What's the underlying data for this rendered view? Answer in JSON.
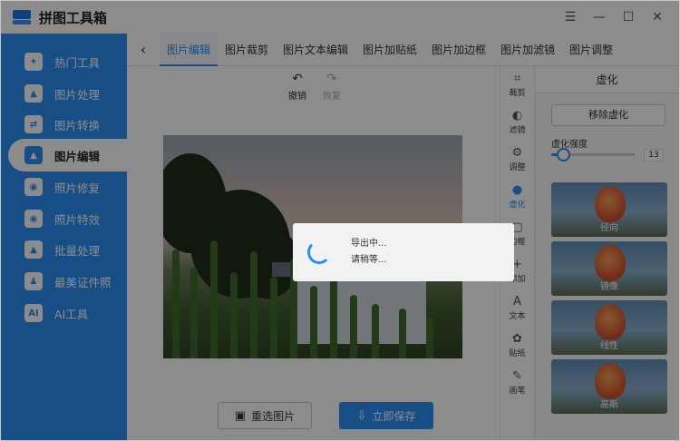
{
  "app": {
    "title": "拼图工具箱"
  },
  "window_controls": {
    "menu": "☰",
    "minimize": "—",
    "maximize": "☐",
    "close": "✕"
  },
  "sidebar": {
    "items": [
      {
        "label": "热门工具",
        "icon": "hot-tools-icon",
        "glyph": "✦",
        "active": false
      },
      {
        "label": "图片处理",
        "icon": "image-process-icon",
        "glyph": "▲",
        "active": false
      },
      {
        "label": "图片转换",
        "icon": "image-convert-icon",
        "glyph": "⇄",
        "active": false
      },
      {
        "label": "图片编辑",
        "icon": "image-edit-icon",
        "glyph": "▲",
        "active": true
      },
      {
        "label": "照片修复",
        "icon": "photo-repair-icon",
        "glyph": "◉",
        "active": false
      },
      {
        "label": "照片特效",
        "icon": "photo-effect-icon",
        "glyph": "◉",
        "active": false
      },
      {
        "label": "批量处理",
        "icon": "batch-process-icon",
        "glyph": "▲",
        "active": false
      },
      {
        "label": "最美证件照",
        "icon": "id-photo-icon",
        "glyph": "♟",
        "active": false
      },
      {
        "label": "AI工具",
        "icon": "ai-tool-icon",
        "glyph": "AI",
        "active": false
      }
    ]
  },
  "tabs": {
    "back_icon": "‹",
    "items": [
      {
        "label": "图片编辑",
        "active": true
      },
      {
        "label": "图片裁剪",
        "active": false
      },
      {
        "label": "图片文本编辑",
        "active": false
      },
      {
        "label": "图片加贴纸",
        "active": false
      },
      {
        "label": "图片加边框",
        "active": false
      },
      {
        "label": "图片加滤镜",
        "active": false
      },
      {
        "label": "图片调整",
        "active": false
      }
    ]
  },
  "editor": {
    "undo": {
      "label": "撤销",
      "glyph": "↶"
    },
    "redo": {
      "label": "恢复",
      "glyph": "↷"
    }
  },
  "actions": {
    "reselect": {
      "label": "重选图片",
      "glyph": "▣"
    },
    "save": {
      "label": "立即保存",
      "glyph": "⇩"
    }
  },
  "toolstrip": {
    "items": [
      {
        "label": "裁剪",
        "glyph": "⌗",
        "active": false
      },
      {
        "label": "滤镜",
        "glyph": "◐",
        "active": false
      },
      {
        "label": "调整",
        "glyph": "⚙",
        "active": false
      },
      {
        "label": "虚化",
        "glyph": "●",
        "active": true
      },
      {
        "label": "边框",
        "glyph": "▢",
        "active": false
      },
      {
        "label": "添加",
        "glyph": "+",
        "active": false
      },
      {
        "label": "文本",
        "glyph": "A",
        "active": false
      },
      {
        "label": "贴纸",
        "glyph": "✿",
        "active": false
      },
      {
        "label": "画笔",
        "glyph": "✎",
        "active": false
      }
    ]
  },
  "panel": {
    "title": "虚化",
    "remove_label": "移除虚化",
    "strength_label": "虚化强度",
    "strength_value": "13",
    "strength_fraction": 0.14,
    "presets": [
      {
        "label": "径向"
      },
      {
        "label": "镜像"
      },
      {
        "label": "线性"
      },
      {
        "label": "高斯"
      }
    ]
  },
  "dialog": {
    "line1": "导出中...",
    "line2": "请稍等..."
  },
  "colors": {
    "accent": "#2b8ef2"
  }
}
